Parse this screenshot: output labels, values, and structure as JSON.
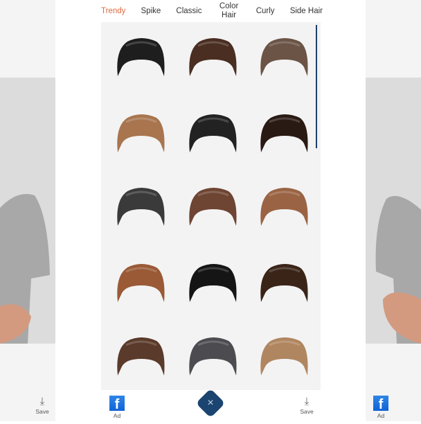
{
  "tabs": [
    {
      "label": "Trendy",
      "active": true
    },
    {
      "label": "Spike"
    },
    {
      "label": "Classic"
    },
    {
      "label": "Color Hair"
    },
    {
      "label": "Curly"
    },
    {
      "label": "Side Hair"
    }
  ],
  "accent_color": "#e0683f",
  "hairstyles_colors": [
    "#1e1e1e",
    "#4a2e22",
    "#6b5446",
    "#a8754f",
    "#222222",
    "#2a1a14",
    "#3a3a3a",
    "#6e4432",
    "#9a6444",
    "#9a5a36",
    "#151515",
    "#3a2418",
    "#5a3a2a",
    "#4c4c50",
    "#b08660"
  ],
  "bottom_bar": {
    "save_label": "Save",
    "ad_label": "Ad",
    "fb_letter": "f",
    "close_icon": "×"
  }
}
